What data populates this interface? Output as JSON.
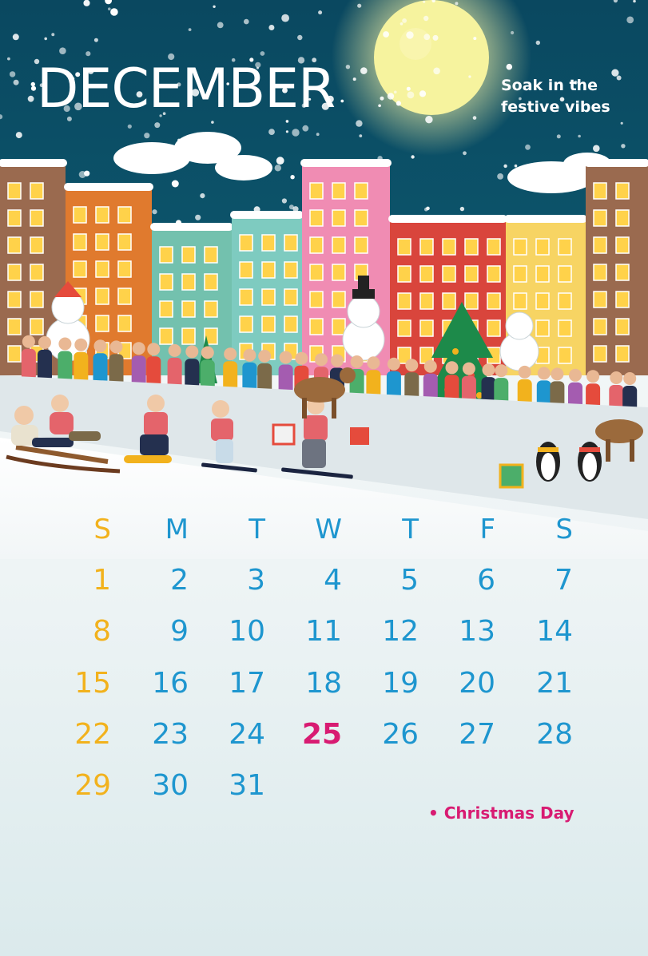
{
  "header": {
    "month": "DECEMBER",
    "tagline_line1": "Soak in the",
    "tagline_line2": "festive vibes"
  },
  "calendar": {
    "weekdays": [
      "S",
      "M",
      "T",
      "W",
      "T",
      "F",
      "S"
    ],
    "weeks": [
      [
        "1",
        "2",
        "3",
        "4",
        "5",
        "6",
        "7"
      ],
      [
        "8",
        "9",
        "10",
        "11",
        "12",
        "13",
        "14"
      ],
      [
        "15",
        "16",
        "17",
        "18",
        "19",
        "20",
        "21"
      ],
      [
        "22",
        "23",
        "24",
        "25",
        "26",
        "27",
        "28"
      ],
      [
        "29",
        "30",
        "31",
        "",
        "",
        "",
        ""
      ]
    ],
    "highlighted_day": "25"
  },
  "legend": {
    "holiday": "• Christmas Day"
  },
  "colors": {
    "sky": "#0b5068",
    "sunday": "#f2b21d",
    "weekday": "#1e96cf",
    "holiday": "#d81b72",
    "text_light": "#ffffff"
  },
  "illustration": {
    "icons": [
      "moon-icon",
      "house-icon",
      "snowman-icon",
      "christmas-tree-icon",
      "reindeer-icon",
      "penguin-icon",
      "skier-icon",
      "sled-icon",
      "gift-icon"
    ]
  }
}
